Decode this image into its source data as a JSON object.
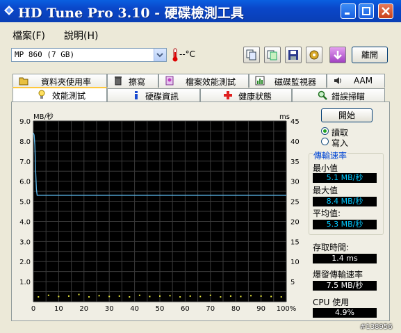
{
  "window": {
    "title": "HD Tune Pro 3.10 - 硬碟檢測工具"
  },
  "menu": [
    {
      "label": "檔案(F)"
    },
    {
      "label": "說明(H)"
    }
  ],
  "toolbar": {
    "drive": "MP      860 (7 GB)",
    "temperature": "--°C",
    "exit_label": "離開"
  },
  "tabs_row1": [
    {
      "label": "資料夾使用率",
      "icon": "folder-icon"
    },
    {
      "label": "擦寫",
      "icon": "trash-icon"
    },
    {
      "label": "檔案效能測試",
      "icon": "file-benchmark-icon"
    },
    {
      "label": "磁碟監視器",
      "icon": "disk-monitor-icon"
    },
    {
      "label": "AAM",
      "icon": "speaker-icon"
    }
  ],
  "tabs_row2": [
    {
      "label": "效能測試",
      "icon": "lightbulb-icon"
    },
    {
      "label": "硬碟資訊",
      "icon": "info-icon"
    },
    {
      "label": "健康狀態",
      "icon": "health-cross-icon"
    },
    {
      "label": "錯誤掃瞄",
      "icon": "magnifier-icon"
    }
  ],
  "controls": {
    "start_label": "開始",
    "read_label": "讀取",
    "write_label": "寫入",
    "selected": "read"
  },
  "stats": {
    "transfer_title": "傳輸速率",
    "min_label": "最小值",
    "min_value": "5.1 MB/秒",
    "max_label": "最大值",
    "max_value": "8.4 MB/秒",
    "avg_label": "平均值:",
    "avg_value": "5.3 MB/秒",
    "access_label": "存取時間:",
    "access_value": "1.4 ms",
    "burst_label": "爆發傳輸速率",
    "burst_value": "7.5 MB/秒",
    "cpu_label": "CPU 使用",
    "cpu_value": "4.9%"
  },
  "chart_data": {
    "type": "line",
    "ylabel_left": "MB/秒",
    "ylabel_right": "ms",
    "left_ticks": [
      "9.0",
      "8.0",
      "7.0",
      "6.0",
      "5.0",
      "4.0",
      "3.0",
      "2.0",
      "1.0"
    ],
    "right_ticks": [
      "45",
      "40",
      "35",
      "30",
      "25",
      "20",
      "15",
      "10",
      "5"
    ],
    "x_ticks": [
      "0",
      "10",
      "20",
      "30",
      "40",
      "50",
      "60",
      "70",
      "80",
      "90",
      "100%"
    ],
    "xlim": [
      0,
      100
    ],
    "ylim_left": [
      0,
      9
    ],
    "ylim_right": [
      0,
      45
    ],
    "grid": true,
    "colors": {
      "background": "#000000",
      "grid": "#3a3a3a",
      "transfer": "#5ab4e6",
      "access": "#e6e63c"
    },
    "series": [
      {
        "name": "transfer",
        "x": [
          0,
          0.3,
          0.6,
          0.9,
          1.2,
          1.5,
          3,
          10,
          20,
          30,
          40,
          50,
          60,
          70,
          80,
          90,
          100
        ],
        "values": [
          8.4,
          8.3,
          7.8,
          6.5,
          5.6,
          5.3,
          5.3,
          5.3,
          5.3,
          5.3,
          5.3,
          5.3,
          5.3,
          5.3,
          5.3,
          5.3,
          5.3
        ]
      },
      {
        "name": "access",
        "x": [
          2,
          6,
          10,
          14,
          18,
          22,
          26,
          30,
          34,
          38,
          42,
          46,
          50,
          54,
          58,
          62,
          66,
          70,
          74,
          78,
          82,
          86,
          90,
          94,
          98
        ],
        "values": [
          1.2,
          1.6,
          1.3,
          1.4,
          1.8,
          1.2,
          1.5,
          1.3,
          1.4,
          1.2,
          1.6,
          1.3,
          1.4,
          1.5,
          1.2,
          1.4,
          1.3,
          1.6,
          1.2,
          1.4,
          1.3,
          1.5,
          1.4,
          1.3,
          1.2
        ]
      }
    ]
  },
  "watermark": "#138956"
}
